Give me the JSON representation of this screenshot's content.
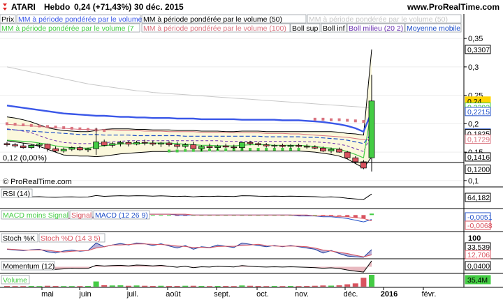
{
  "header": {
    "symbol": "ATARI",
    "period": "Hebdo",
    "quote": "0,24 (+71,43%)",
    "date": "30 déc. 2015",
    "site": "www.ProRealTime.com"
  },
  "legend_tags": [
    {
      "label": "Prix",
      "color": "#000000"
    },
    {
      "label": "MM à période pondérée par le volume (20)",
      "color": "#3a57e8"
    },
    {
      "label": "MM à période pondérée par le volume (50)",
      "color": "#000000"
    },
    {
      "label": "MM à période pondérée par le volume (50)",
      "color": "#c8c8c8"
    },
    {
      "label": "MM à période pondérée par le volume (7",
      "color": "#44cc44"
    },
    {
      "label": "MM à période pondérée par le volume (100)",
      "color": "#d9737f"
    },
    {
      "label": "Boll sup",
      "color": "#000000"
    },
    {
      "label": "Boll inf",
      "color": "#000000"
    },
    {
      "label": "Boll milieu (20 2)",
      "color": "#6a2fb0"
    },
    {
      "label": "Moyenne mobile",
      "color": "#1f4fc8"
    }
  ],
  "main_axis": {
    "ticks": [
      "0,35",
      "0,3",
      "0,25",
      "0,2",
      "0,15",
      "0,1"
    ],
    "boxes": [
      {
        "text": "0,3307",
        "color": "#000000",
        "value": 0.3307
      },
      {
        "text": "0,24",
        "color": "#ffd400",
        "value": 0.24
      },
      {
        "text": "0,2292",
        "color": "#44cc44",
        "value": 0.2292
      },
      {
        "text": "0,2215",
        "color": "#1f4fc8",
        "value": 0.2215
      },
      {
        "text": "0,1835",
        "color": "#1f4fc8",
        "value": 0.1835
      },
      {
        "text": "0,1825",
        "color": "#000000",
        "value": 0.1825
      },
      {
        "text": "0,1729",
        "color": "#d9737f",
        "value": 0.1729
      },
      {
        "text": "0,1416",
        "color": "#000000",
        "value": 0.1416
      },
      {
        "text": "0,1200",
        "color": "#000000",
        "value": 0.12
      }
    ]
  },
  "ref_line_label": "0,12 (0,00%)",
  "copyright": "© ProRealTime.com",
  "subpanels": {
    "rsi": {
      "label": "RSI (14)",
      "value": "64,182"
    },
    "macd": {
      "tag_a": "MACD moins Signal",
      "tag_b": "Signal",
      "tag_c": "MACD (12 26 9)",
      "value_a": "-0,0051",
      "value_b": "-0,0068"
    },
    "stoch": {
      "tag_a": "Stoch %K",
      "tag_b": "Stoch %D (14 3 5)",
      "top": "100",
      "value_a": "33,539",
      "value_b": "12,706"
    },
    "momentum": {
      "label": "Momentum (12)",
      "value": "0,0400"
    },
    "volume": {
      "label": "Volume",
      "value": "35,4M"
    }
  },
  "x_axis": [
    "mai",
    "juin",
    "juil.",
    "août",
    "sept.",
    "oct.",
    "nov.",
    "déc.",
    "2016",
    "févr."
  ],
  "chart_data": {
    "type": "candlestick",
    "period": "weekly",
    "ylim": [
      0.09,
      0.36
    ],
    "candles": [
      {
        "open": 0.165,
        "high": 0.168,
        "low": 0.16,
        "close": 0.163
      },
      {
        "open": 0.163,
        "high": 0.166,
        "low": 0.158,
        "close": 0.161
      },
      {
        "open": 0.161,
        "high": 0.166,
        "low": 0.156,
        "close": 0.158
      },
      {
        "open": 0.158,
        "high": 0.164,
        "low": 0.155,
        "close": 0.162
      },
      {
        "open": 0.162,
        "high": 0.166,
        "low": 0.157,
        "close": 0.164
      },
      {
        "open": 0.164,
        "high": 0.165,
        "low": 0.151,
        "close": 0.156
      },
      {
        "open": 0.156,
        "high": 0.16,
        "low": 0.15,
        "close": 0.152
      },
      {
        "open": 0.152,
        "high": 0.158,
        "low": 0.149,
        "close": 0.155
      },
      {
        "open": 0.155,
        "high": 0.16,
        "low": 0.152,
        "close": 0.158
      },
      {
        "open": 0.158,
        "high": 0.161,
        "low": 0.152,
        "close": 0.154
      },
      {
        "open": 0.154,
        "high": 0.158,
        "low": 0.15,
        "close": 0.156
      },
      {
        "open": 0.156,
        "high": 0.193,
        "low": 0.145,
        "close": 0.168
      },
      {
        "open": 0.168,
        "high": 0.172,
        "low": 0.16,
        "close": 0.162
      },
      {
        "open": 0.162,
        "high": 0.168,
        "low": 0.158,
        "close": 0.165
      },
      {
        "open": 0.165,
        "high": 0.17,
        "low": 0.16,
        "close": 0.167
      },
      {
        "open": 0.167,
        "high": 0.17,
        "low": 0.16,
        "close": 0.164
      },
      {
        "open": 0.164,
        "high": 0.17,
        "low": 0.162,
        "close": 0.167
      },
      {
        "open": 0.167,
        "high": 0.172,
        "low": 0.162,
        "close": 0.166
      },
      {
        "open": 0.166,
        "high": 0.17,
        "low": 0.161,
        "close": 0.164
      },
      {
        "open": 0.164,
        "high": 0.168,
        "low": 0.159,
        "close": 0.166
      },
      {
        "open": 0.166,
        "high": 0.169,
        "low": 0.16,
        "close": 0.163
      },
      {
        "open": 0.163,
        "high": 0.168,
        "low": 0.156,
        "close": 0.16
      },
      {
        "open": 0.16,
        "high": 0.166,
        "low": 0.157,
        "close": 0.163
      },
      {
        "open": 0.163,
        "high": 0.168,
        "low": 0.158,
        "close": 0.156
      },
      {
        "open": 0.156,
        "high": 0.162,
        "low": 0.152,
        "close": 0.16
      },
      {
        "open": 0.16,
        "high": 0.165,
        "low": 0.156,
        "close": 0.158
      },
      {
        "open": 0.158,
        "high": 0.163,
        "low": 0.154,
        "close": 0.161
      },
      {
        "open": 0.161,
        "high": 0.165,
        "low": 0.157,
        "close": 0.159
      },
      {
        "open": 0.159,
        "high": 0.163,
        "low": 0.155,
        "close": 0.158
      },
      {
        "open": 0.158,
        "high": 0.166,
        "low": 0.154,
        "close": 0.167
      },
      {
        "open": 0.167,
        "high": 0.17,
        "low": 0.162,
        "close": 0.165
      },
      {
        "open": 0.165,
        "high": 0.168,
        "low": 0.16,
        "close": 0.163
      },
      {
        "open": 0.163,
        "high": 0.166,
        "low": 0.158,
        "close": 0.161
      },
      {
        "open": 0.161,
        "high": 0.164,
        "low": 0.157,
        "close": 0.162
      },
      {
        "open": 0.162,
        "high": 0.165,
        "low": 0.158,
        "close": 0.16
      },
      {
        "open": 0.16,
        "high": 0.164,
        "low": 0.156,
        "close": 0.162
      },
      {
        "open": 0.162,
        "high": 0.165,
        "low": 0.158,
        "close": 0.16
      },
      {
        "open": 0.16,
        "high": 0.164,
        "low": 0.156,
        "close": 0.159
      },
      {
        "open": 0.159,
        "high": 0.162,
        "low": 0.155,
        "close": 0.157
      },
      {
        "open": 0.157,
        "high": 0.16,
        "low": 0.15,
        "close": 0.152
      },
      {
        "open": 0.152,
        "high": 0.158,
        "low": 0.148,
        "close": 0.155
      },
      {
        "open": 0.155,
        "high": 0.158,
        "low": 0.149,
        "close": 0.15
      },
      {
        "open": 0.15,
        "high": 0.152,
        "low": 0.138,
        "close": 0.14
      },
      {
        "open": 0.14,
        "high": 0.143,
        "low": 0.13,
        "close": 0.133
      },
      {
        "open": 0.133,
        "high": 0.136,
        "low": 0.12,
        "close": 0.122
      },
      {
        "open": 0.14,
        "high": 0.286,
        "low": 0.116,
        "close": 0.24
      }
    ],
    "indicators": {
      "mm20_volume_weighted": [
        0.232,
        0.23,
        0.228,
        0.226,
        0.224,
        0.222,
        0.22,
        0.218,
        0.217,
        0.216,
        0.215,
        0.214,
        0.214,
        0.213,
        0.212,
        0.212,
        0.211,
        0.211,
        0.21,
        0.21,
        0.21,
        0.209,
        0.209,
        0.209,
        0.208,
        0.208,
        0.208,
        0.208,
        0.208,
        0.207,
        0.207,
        0.207,
        0.207,
        0.207,
        0.206,
        0.206,
        0.206,
        0.205,
        0.204,
        0.203,
        0.201,
        0.199,
        0.196,
        0.192,
        0.186,
        0.2215
      ],
      "moyenne_mobile": [
        0.19,
        0.189,
        0.188,
        0.187,
        0.186,
        0.185,
        0.184,
        0.183,
        0.182,
        0.181,
        0.181,
        0.181,
        0.18,
        0.18,
        0.18,
        0.18,
        0.179,
        0.179,
        0.179,
        0.179,
        0.179,
        0.179,
        0.178,
        0.178,
        0.178,
        0.178,
        0.178,
        0.178,
        0.178,
        0.178,
        0.178,
        0.178,
        0.177,
        0.177,
        0.177,
        0.177,
        0.177,
        0.176,
        0.176,
        0.175,
        0.174,
        0.173,
        0.171,
        0.168,
        0.165,
        0.1835
      ],
      "boll_sup": [
        0.212,
        0.21,
        0.207,
        0.203,
        0.198,
        0.193,
        0.19,
        0.188,
        0.187,
        0.186,
        0.186,
        0.188,
        0.19,
        0.191,
        0.191,
        0.191,
        0.19,
        0.19,
        0.189,
        0.189,
        0.189,
        0.188,
        0.188,
        0.188,
        0.187,
        0.187,
        0.187,
        0.186,
        0.186,
        0.187,
        0.187,
        0.187,
        0.186,
        0.186,
        0.186,
        0.186,
        0.186,
        0.186,
        0.186,
        0.186,
        0.186,
        0.185,
        0.183,
        0.182,
        0.18,
        0.3307
      ],
      "boll_inf": [
        0.17,
        0.168,
        0.166,
        0.164,
        0.16,
        0.155,
        0.15,
        0.145,
        0.144,
        0.143,
        0.143,
        0.142,
        0.143,
        0.145,
        0.147,
        0.148,
        0.149,
        0.15,
        0.151,
        0.151,
        0.151,
        0.152,
        0.152,
        0.152,
        0.152,
        0.152,
        0.152,
        0.152,
        0.152,
        0.152,
        0.152,
        0.152,
        0.152,
        0.152,
        0.152,
        0.152,
        0.152,
        0.151,
        0.15,
        0.148,
        0.146,
        0.143,
        0.138,
        0.13,
        0.122,
        0.1416
      ],
      "boll_milieu": [
        0.191,
        0.189,
        0.187,
        0.184,
        0.179,
        0.174,
        0.17,
        0.167,
        0.166,
        0.165,
        0.165,
        0.165,
        0.166,
        0.168,
        0.169,
        0.17,
        0.17,
        0.17,
        0.17,
        0.17,
        0.17,
        0.17,
        0.17,
        0.17,
        0.17,
        0.17,
        0.17,
        0.169,
        0.169,
        0.169,
        0.169,
        0.169,
        0.169,
        0.169,
        0.169,
        0.169,
        0.169,
        0.168,
        0.168,
        0.167,
        0.166,
        0.164,
        0.161,
        0.156,
        0.151,
        0.1825
      ],
      "mm50_grey": [
        0.3,
        0.297,
        0.294,
        0.291,
        0.288,
        0.285,
        0.282,
        0.279,
        0.276,
        0.273,
        0.27,
        0.268,
        0.266,
        0.264,
        0.262,
        0.26,
        0.258,
        0.257,
        0.255,
        0.254,
        0.253,
        0.252,
        0.251,
        0.25,
        0.249,
        0.248,
        0.247,
        0.246,
        0.245,
        0.244,
        0.243,
        0.242,
        0.241,
        0.24,
        0.239,
        0.238,
        0.237,
        0.236,
        0.235,
        0.234,
        0.233,
        0.232,
        0.231,
        0.23,
        0.229,
        0.228
      ],
      "mm_green": [
        0.171,
        0.17,
        0.169,
        0.168,
        0.166,
        0.164,
        0.161,
        0.159,
        0.158,
        0.157,
        0.157,
        0.16,
        0.161,
        0.163,
        0.164,
        0.165,
        0.165,
        0.166,
        0.166,
        0.166,
        0.166,
        0.165,
        0.164,
        0.163,
        0.162,
        0.162,
        0.161,
        0.161,
        0.161,
        0.162,
        0.163,
        0.163,
        0.163,
        0.162,
        0.162,
        0.162,
        0.162,
        0.161,
        0.16,
        0.158,
        0.157,
        0.155,
        0.151,
        0.146,
        0.14,
        0.2292
      ],
      "sar_green_dots": [
        null,
        null,
        null,
        null,
        null,
        null,
        null,
        null,
        null,
        null,
        null,
        null,
        null,
        null,
        null,
        null,
        null,
        null,
        null,
        null,
        0.152,
        0.152,
        0.153,
        0.153,
        0.153,
        0.154,
        0.154,
        0.154,
        0.155,
        0.155,
        0.155,
        0.155,
        0.155,
        0.155,
        0.155,
        0.155,
        0.155,
        null,
        null,
        null,
        null,
        null,
        null,
        null,
        null,
        null
      ],
      "sar_red_dots": [
        0.2,
        0.199,
        0.198,
        0.197,
        0.196,
        0.195,
        0.194,
        0.193,
        0.192,
        0.191,
        0.19,
        0.189,
        0.188,
        null,
        null,
        null,
        null,
        null,
        null,
        null,
        null,
        null,
        null,
        null,
        null,
        null,
        null,
        null,
        null,
        null,
        null,
        null,
        null,
        null,
        null,
        null,
        null,
        null,
        0.208,
        0.208,
        0.207,
        0.207,
        0.206,
        0.205,
        0.204,
        null
      ],
      "mm100_pink": [
        0.199,
        0.198,
        0.197,
        0.196,
        0.195,
        0.194,
        0.193,
        0.192,
        0.191,
        0.19,
        0.19,
        0.189,
        0.189,
        0.189,
        0.188,
        0.188,
        0.188,
        0.187,
        0.187,
        0.187,
        0.186,
        0.186,
        0.186,
        0.186,
        0.185,
        0.185,
        0.185,
        0.185,
        0.184,
        0.184,
        0.184,
        0.184,
        0.183,
        0.183,
        0.183,
        0.182,
        0.182,
        0.181,
        0.18,
        0.179,
        0.178,
        0.177,
        0.176,
        0.174,
        0.172,
        0.1729
      ]
    },
    "rsi": [
      48,
      47,
      46,
      47,
      48,
      45,
      44,
      46,
      47,
      45,
      46,
      55,
      50,
      52,
      54,
      52,
      54,
      53,
      51,
      53,
      51,
      49,
      51,
      47,
      50,
      49,
      51,
      50,
      49,
      54,
      53,
      51,
      50,
      51,
      50,
      51,
      50,
      49,
      48,
      45,
      47,
      44,
      38,
      34,
      30,
      64.182
    ],
    "macd": [
      -0.004,
      -0.004,
      -0.004,
      -0.004,
      -0.004,
      -0.004,
      -0.004,
      -0.004,
      -0.004,
      -0.004,
      -0.003,
      -0.002,
      -0.001,
      0.0,
      0.001,
      0.001,
      0.001,
      0.001,
      0.001,
      0.001,
      0.001,
      0.0,
      0.0,
      0.0,
      0.0,
      0.0,
      0.0,
      0.0,
      0.0,
      0.0,
      0.0,
      0.0,
      0.0,
      0.0,
      0.0,
      0.0,
      -0.001,
      -0.001,
      -0.001,
      -0.002,
      -0.002,
      -0.003,
      -0.004,
      -0.006,
      -0.008,
      -0.0051
    ],
    "macd_signal": [
      -0.003,
      -0.003,
      -0.003,
      -0.003,
      -0.003,
      -0.003,
      -0.003,
      -0.004,
      -0.004,
      -0.004,
      -0.004,
      -0.003,
      -0.003,
      -0.002,
      -0.001,
      0.0,
      0.0,
      0.001,
      0.001,
      0.001,
      0.001,
      0.001,
      0.001,
      0.0,
      0.0,
      0.0,
      0.0,
      0.0,
      0.0,
      0.0,
      0.0,
      0.0,
      0.0,
      0.0,
      0.0,
      0.0,
      0.0,
      0.0,
      -0.001,
      -0.001,
      -0.001,
      -0.002,
      -0.002,
      -0.003,
      -0.004,
      -0.0068
    ],
    "stoch_k": [
      35,
      32,
      30,
      33,
      35,
      25,
      20,
      28,
      32,
      27,
      30,
      60,
      45,
      52,
      58,
      52,
      60,
      57,
      50,
      57,
      48,
      40,
      50,
      35,
      45,
      42,
      52,
      47,
      42,
      60,
      55,
      50,
      45,
      50,
      45,
      50,
      45,
      40,
      35,
      20,
      30,
      18,
      8,
      5,
      3,
      33.539
    ],
    "stoch_d": [
      36,
      34,
      32,
      32,
      33,
      31,
      27,
      24,
      27,
      29,
      30,
      40,
      45,
      52,
      52,
      54,
      56,
      56,
      55,
      54,
      52,
      48,
      46,
      42,
      43,
      41,
      46,
      47,
      47,
      50,
      52,
      55,
      50,
      48,
      47,
      48,
      47,
      45,
      40,
      32,
      28,
      23,
      18,
      11,
      5,
      12.706
    ],
    "momentum": [
      -0.01,
      -0.012,
      -0.013,
      -0.011,
      -0.009,
      -0.015,
      -0.018,
      -0.014,
      -0.01,
      -0.012,
      -0.011,
      0.01,
      0.005,
      0.008,
      0.01,
      0.006,
      0.012,
      0.01,
      0.006,
      0.01,
      0.003,
      -0.003,
      0.004,
      -0.006,
      0.0,
      -0.002,
      0.004,
      0.001,
      -0.001,
      0.008,
      0.004,
      0.0,
      -0.002,
      0.0,
      -0.002,
      0.0,
      -0.002,
      -0.004,
      -0.006,
      -0.01,
      -0.007,
      -0.012,
      -0.022,
      -0.03,
      -0.036,
      0.04
    ],
    "volume_millions": [
      0.5,
      0.4,
      0.4,
      0.5,
      0.4,
      0.6,
      0.5,
      0.4,
      0.4,
      0.4,
      0.5,
      3.5,
      1.0,
      0.8,
      0.9,
      0.6,
      0.8,
      0.6,
      0.5,
      0.6,
      0.5,
      0.5,
      0.6,
      0.6,
      0.5,
      0.4,
      0.5,
      0.5,
      0.4,
      0.8,
      0.6,
      0.5,
      0.4,
      0.5,
      0.4,
      0.5,
      0.4,
      0.5,
      0.6,
      0.8,
      0.7,
      0.9,
      1.6,
      2.2,
      6.0,
      35.4
    ]
  }
}
